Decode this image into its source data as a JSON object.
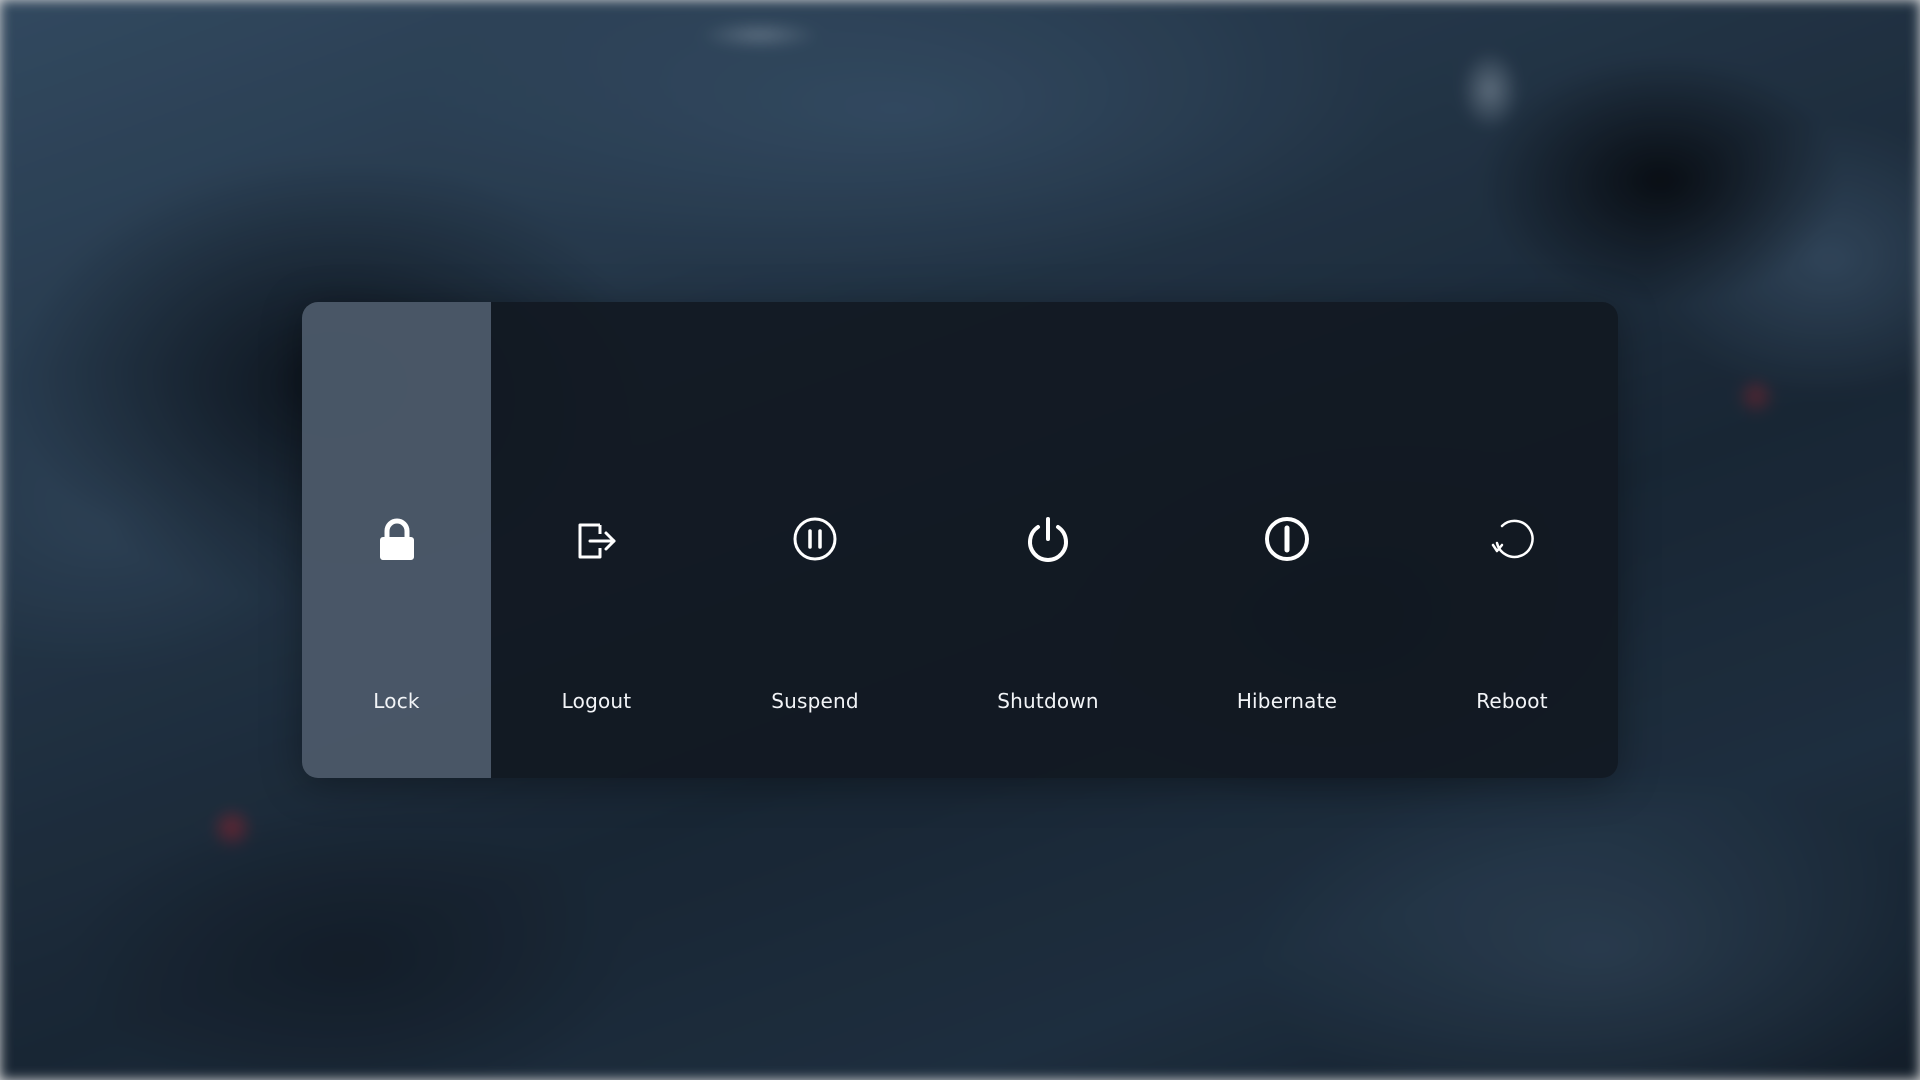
{
  "power_menu": {
    "selected": "lock",
    "options": [
      {
        "id": "lock",
        "label": "Lock",
        "icon": "lock-icon"
      },
      {
        "id": "logout",
        "label": "Logout",
        "icon": "logout-icon"
      },
      {
        "id": "suspend",
        "label": "Suspend",
        "icon": "pause-circle-icon"
      },
      {
        "id": "shutdown",
        "label": "Shutdown",
        "icon": "power-icon"
      },
      {
        "id": "hibernate",
        "label": "Hibernate",
        "icon": "hibernate-icon"
      },
      {
        "id": "reboot",
        "label": "Reboot",
        "icon": "reboot-icon"
      }
    ]
  },
  "colors": {
    "panel_background": "#121821",
    "selected_background": "#58687a",
    "text": "#f2f4f7"
  }
}
